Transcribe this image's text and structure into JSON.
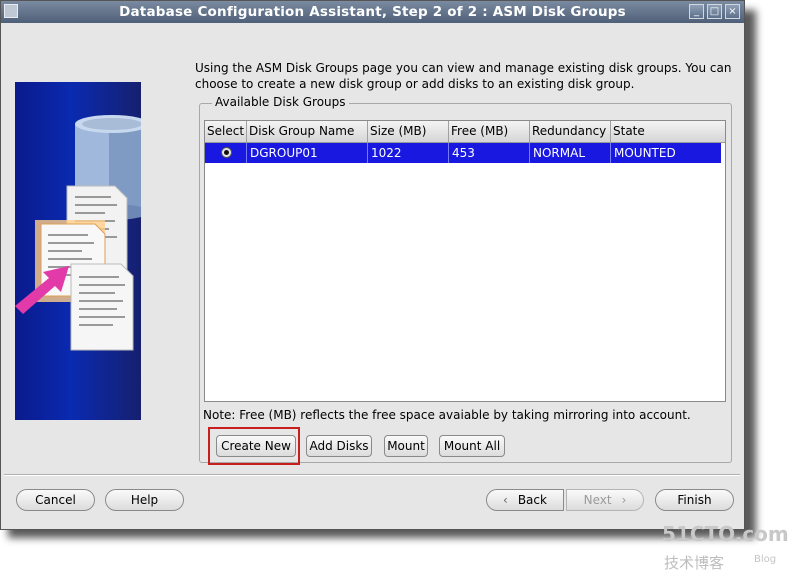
{
  "window": {
    "title": "Database Configuration Assistant, Step 2 of 2 : ASM Disk Groups",
    "controls": {
      "minimize": "_",
      "maximize": "□",
      "close": "×"
    }
  },
  "intro_text": "Using the ASM Disk Groups page you can view and manage existing disk groups. You can choose to create a new disk group or add disks to an existing disk group.",
  "group_label": "Available Disk Groups",
  "table": {
    "columns": [
      "Select",
      "Disk Group Name",
      "Size (MB)",
      "Free (MB)",
      "Redundancy",
      "State"
    ],
    "rows": [
      {
        "name": "DGROUP01",
        "size": "1022",
        "free": "453",
        "redundancy": "NORMAL",
        "state": "MOUNTED",
        "selected": true
      }
    ]
  },
  "note": "Note: Free (MB) reflects the free space avaiable by taking mirroring into account.",
  "actions": {
    "create_new": "Create New",
    "add_disks": "Add Disks",
    "mount": "Mount",
    "mount_all": "Mount All"
  },
  "footer": {
    "cancel": "Cancel",
    "help": "Help",
    "back": "Back",
    "next": "Next",
    "finish": "Finish"
  },
  "watermark": {
    "line1": "51CTO.com",
    "line2": "技术博客",
    "line3": "Blog"
  },
  "colors": {
    "selection": "#1818e0",
    "titlebar": "#5a6a84",
    "highlight_box": "#c81e1e",
    "banner": "#0a2ab0"
  }
}
